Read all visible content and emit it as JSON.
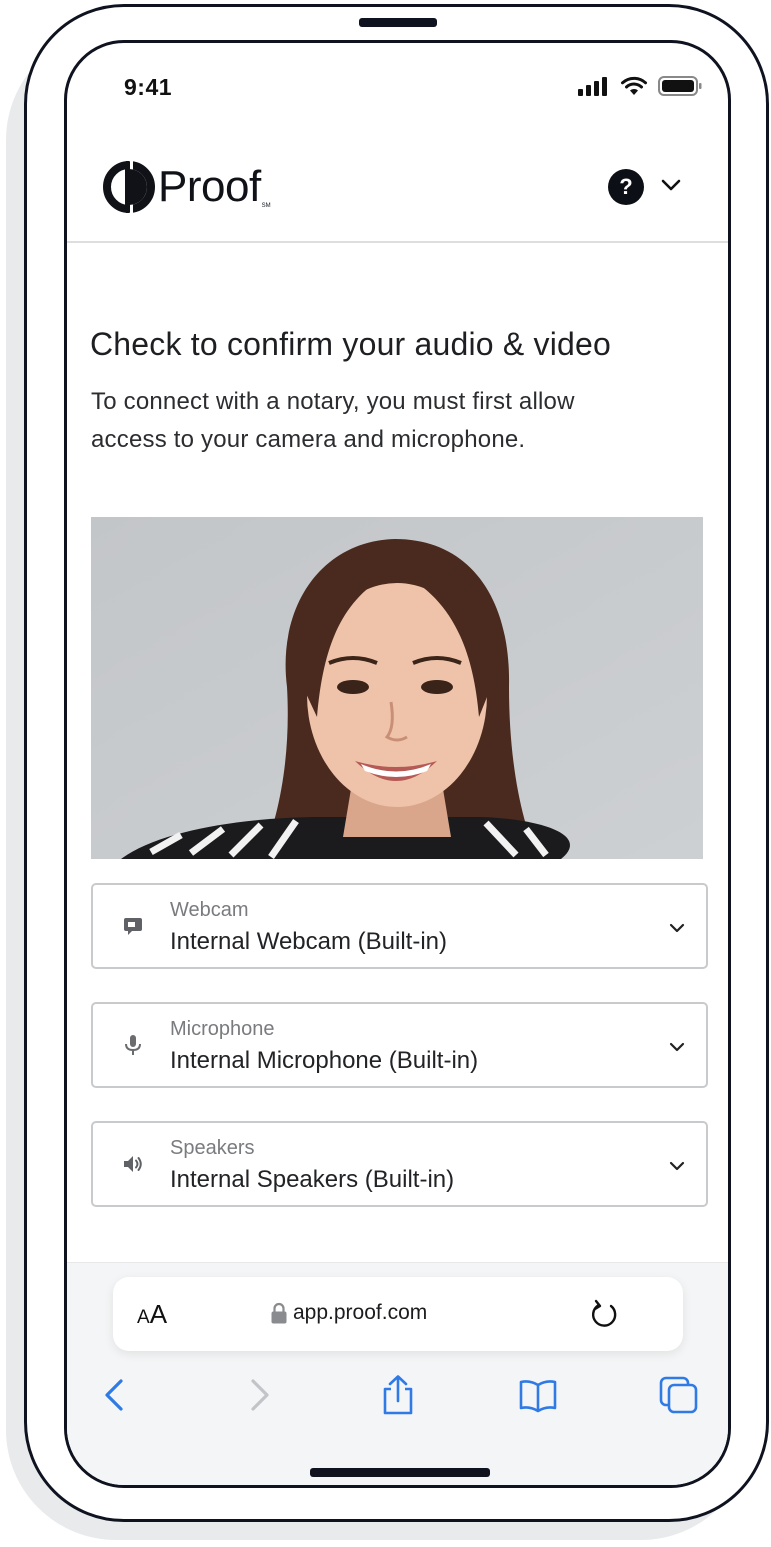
{
  "status_bar": {
    "time": "9:41"
  },
  "header": {
    "logo_text": "Proof",
    "logo_mark": "SM",
    "help_label": "?",
    "icons": [
      "proof-logo-icon",
      "help-icon",
      "chevron-down-icon"
    ]
  },
  "main": {
    "title": "Check to confirm your audio & video",
    "description": "To connect with a notary, you must first allow access to your camera and microphone.",
    "devices": [
      {
        "label": "Webcam",
        "value": "Internal Webcam (Built-in)",
        "icon": "webcam-icon"
      },
      {
        "label": "Microphone",
        "value": "Internal Microphone (Built-in)",
        "icon": "microphone-icon"
      },
      {
        "label": "Speakers",
        "value": "Internal Speakers (Built-in)",
        "icon": "speaker-icon"
      }
    ]
  },
  "browser": {
    "text_size_label_small": "A",
    "text_size_label_large": "A",
    "url": "app.proof.com",
    "nav_icons": [
      "back-icon",
      "forward-icon",
      "share-icon",
      "bookmarks-icon",
      "tabs-icon"
    ]
  },
  "colors": {
    "ios_blue": "#2f7ae5",
    "dark": "#0f1320",
    "border": "#c9cacc",
    "video_bg": "#c6c9cc"
  }
}
